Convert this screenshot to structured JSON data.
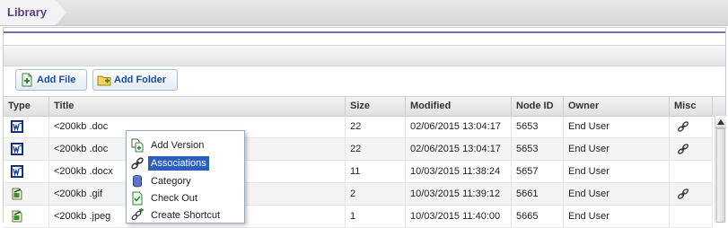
{
  "tab": {
    "label": "Library"
  },
  "toolbar": {
    "add_file": "Add File",
    "add_folder": "Add Folder"
  },
  "columns": {
    "type": "Type",
    "title": "Title",
    "size": "Size",
    "modified": "Modified",
    "node_id": "Node ID",
    "owner": "Owner",
    "misc": "Misc"
  },
  "rows": [
    {
      "type_icon": "word-doc-icon",
      "title": "<200kb .doc",
      "size": "22",
      "modified": "02/06/2015 13:04:17",
      "node_id": "5653",
      "owner": "End User",
      "misc_icon": "link-icon"
    },
    {
      "type_icon": "word-doc-icon",
      "title": "<200kb .doc",
      "size": "22",
      "modified": "02/06/2015 13:04:17",
      "node_id": "5653",
      "owner": "End User",
      "misc_icon": "link-icon"
    },
    {
      "type_icon": "word-doc-icon",
      "title": "<200kb .docx",
      "size": "11",
      "modified": "10/03/2015 11:38:24",
      "node_id": "5657",
      "owner": "End User",
      "misc_icon": ""
    },
    {
      "type_icon": "image-file-icon",
      "title": "<200kb .gif",
      "size": "2",
      "modified": "10/03/2015 11:39:12",
      "node_id": "5661",
      "owner": "End User",
      "misc_icon": "link-icon"
    },
    {
      "type_icon": "image-file-icon",
      "title": "<200kb .jpeg",
      "size": "1",
      "modified": "10/03/2015 11:40:00",
      "node_id": "5665",
      "owner": "End User",
      "misc_icon": ""
    }
  ],
  "context_menu": {
    "items": [
      {
        "label": "Add Version",
        "icon": "add-version-icon",
        "highlighted": false
      },
      {
        "label": "Associations",
        "icon": "link-icon",
        "highlighted": true
      },
      {
        "label": "Category",
        "icon": "category-icon",
        "highlighted": false
      },
      {
        "label": "Check Out",
        "icon": "check-out-icon",
        "highlighted": false
      },
      {
        "label": "Create Shortcut",
        "icon": "shortcut-icon",
        "highlighted": false
      }
    ]
  },
  "colors": {
    "accent": "#5a3f8a",
    "highlight": "#2b5fbf",
    "button_text": "#1b4b9c"
  }
}
